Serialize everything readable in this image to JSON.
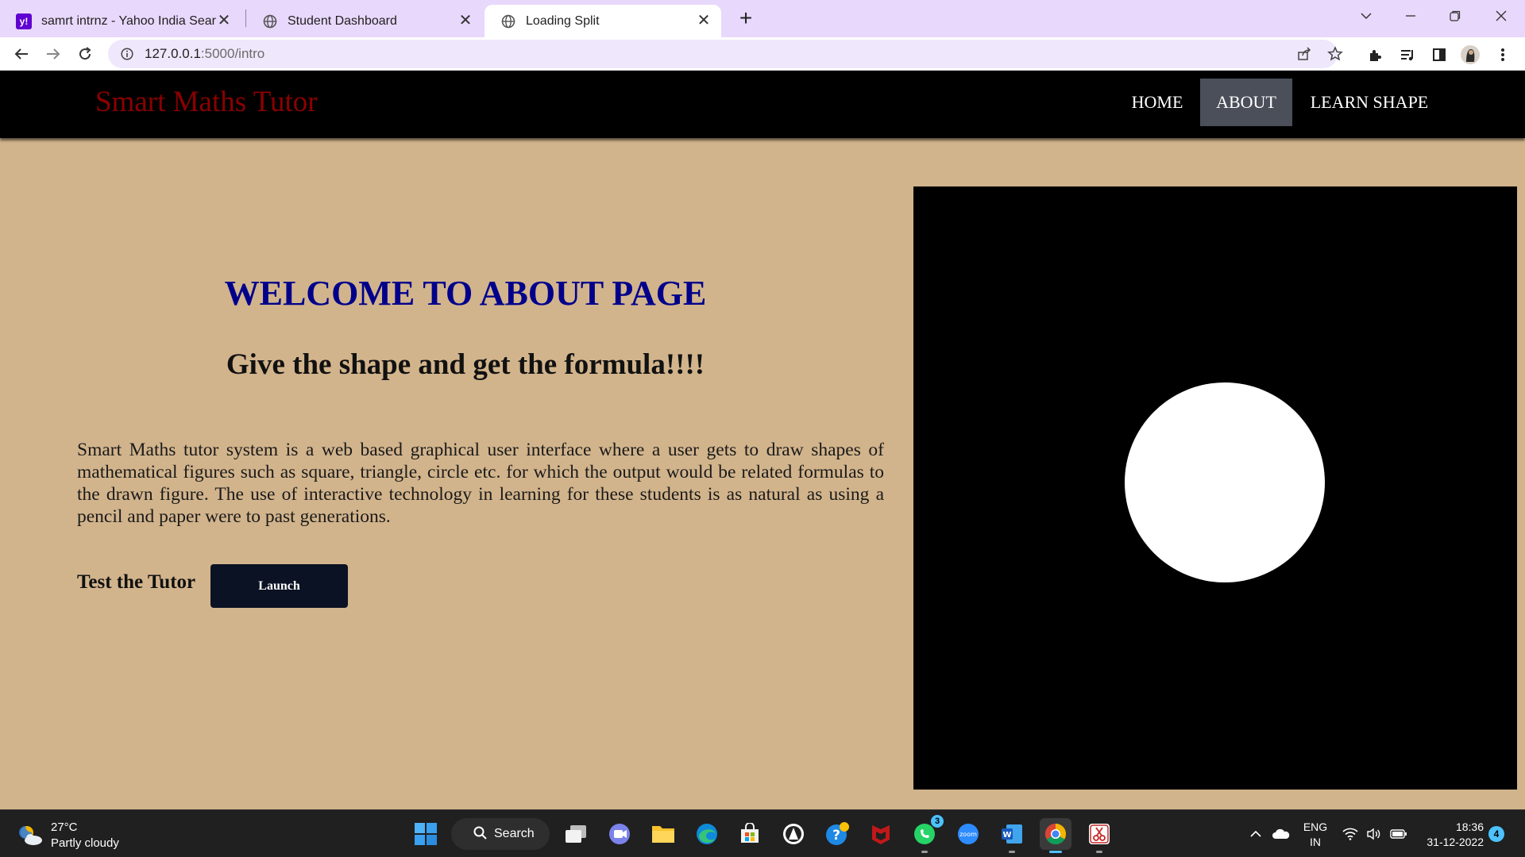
{
  "browser": {
    "tabs": [
      {
        "title": "samrt intrnz - Yahoo India Search",
        "favicon": "yahoo-icon",
        "active": false
      },
      {
        "title": "Student Dashboard",
        "favicon": "globe-icon",
        "active": false
      },
      {
        "title": "Loading Split",
        "favicon": "globe-icon",
        "active": true
      }
    ],
    "url_host": "127.0.0.1",
    "url_path": ":5000/intro"
  },
  "site": {
    "brand": "Smart Maths Tutor",
    "nav": {
      "home": "HOME",
      "about": "ABOUT",
      "learn_shape": "LEARN SHAPE"
    },
    "heading": "WELCOME TO ABOUT PAGE",
    "subheading": "Give the shape and get the formula!!!!",
    "description": "Smart Maths tutor system is a web based graphical user interface where a user gets to draw shapes of mathematical figures such as square, triangle, circle etc. for which the output would be related formulas to the drawn figure. The use of interactive technology in learning for these students is as natural as using a pencil and paper were to past generations.",
    "test_label": "Test the Tutor",
    "launch_label": "Launch",
    "canvas_shape": "circle"
  },
  "taskbar": {
    "weather_temp": "27°C",
    "weather_desc": "Partly cloudy",
    "search_label": "Search",
    "lang_top": "ENG",
    "lang_bottom": "IN",
    "time": "18:36",
    "date": "31-12-2022",
    "notifications": "4",
    "whatsapp_badge": "3"
  },
  "colors": {
    "page_bg": "#d2b48c",
    "brand": "#8b0000",
    "heading": "#00008b",
    "nav_active": "#4a4f5a",
    "launch_bg": "#0b1224",
    "tabbar_bg": "#e8d8fb"
  }
}
